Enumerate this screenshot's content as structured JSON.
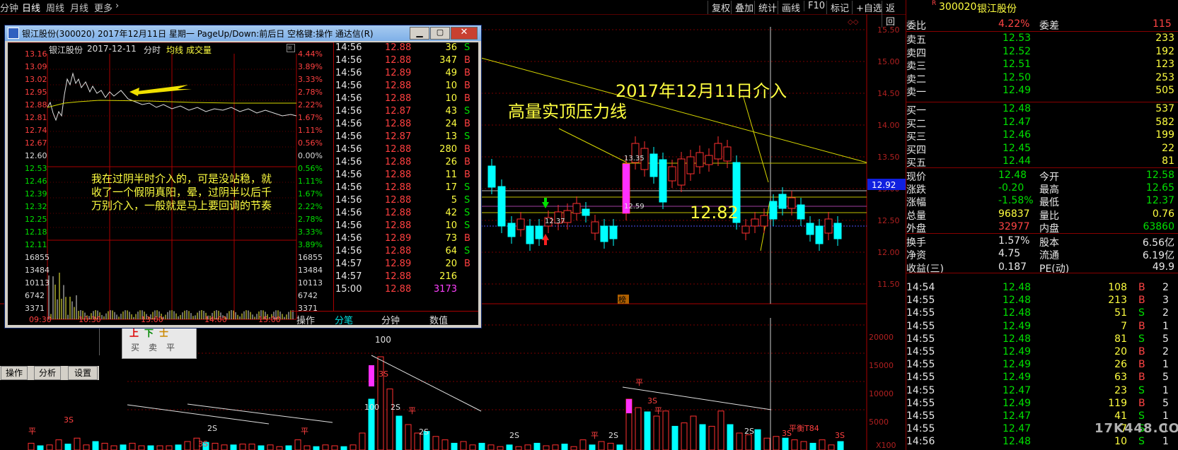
{
  "toolbar": {
    "left_items": [
      "分钟",
      "日线",
      "周线",
      "月线",
      "更多"
    ],
    "active": "日线",
    "right_items": [
      "复权",
      "叠加",
      "统计",
      "画线",
      "F10",
      "标记",
      "+自选",
      "返回"
    ]
  },
  "main_chart": {
    "price_ticks": [
      "15.50",
      "15.00",
      "14.50",
      "14.00",
      "13.50",
      "13.00",
      "12.50",
      "12.00",
      "11.50"
    ],
    "volume_ticks": [
      "20000",
      "15000",
      "10000",
      "5000",
      "X100"
    ],
    "current_price_label": "12.92",
    "annotation_date": "2017年12月11日介入",
    "annotation_line": "高量实顶压力线",
    "annotation_price": "12.82",
    "label_1335": "13.35",
    "label_1259": "12.59",
    "label_1237": "12.37",
    "label_100": "100",
    "small_mark": "榜",
    "vol_labels": [
      "3S",
      "100",
      "2S",
      "平",
      "2S",
      "3S",
      "平",
      "2S",
      "平",
      "3S",
      "平",
      "2S",
      "3S",
      "2S",
      "平",
      "3S",
      "平",
      "2S",
      "3S",
      "平衡T84"
    ]
  },
  "quote": {
    "code": "300020",
    "name": "银江股份",
    "r_mark": "R",
    "weibi_label": "委比",
    "weibi": "4.22%",
    "weicha_label": "委差",
    "weicha": "115",
    "sells": [
      {
        "label": "卖五",
        "price": "12.53",
        "vol": "233"
      },
      {
        "label": "卖四",
        "price": "12.52",
        "vol": "192"
      },
      {
        "label": "卖三",
        "price": "12.51",
        "vol": "123"
      },
      {
        "label": "卖二",
        "price": "12.50",
        "vol": "253"
      },
      {
        "label": "卖一",
        "price": "12.49",
        "vol": "505"
      }
    ],
    "buys": [
      {
        "label": "买一",
        "price": "12.48",
        "vol": "537"
      },
      {
        "label": "买二",
        "price": "12.47",
        "vol": "582"
      },
      {
        "label": "买三",
        "price": "12.46",
        "vol": "199"
      },
      {
        "label": "买四",
        "price": "12.45",
        "vol": "22"
      },
      {
        "label": "买五",
        "price": "12.44",
        "vol": "81"
      }
    ],
    "stats": [
      {
        "l1": "现价",
        "v1": "12.48",
        "c1": "green",
        "l2": "今开",
        "v2": "12.58",
        "c2": "green"
      },
      {
        "l1": "涨跌",
        "v1": "-0.20",
        "c1": "green",
        "l2": "最高",
        "v2": "12.65",
        "c2": "green"
      },
      {
        "l1": "涨幅",
        "v1": "-1.58%",
        "c1": "green",
        "l2": "最低",
        "v2": "12.37",
        "c2": "green"
      },
      {
        "l1": "总量",
        "v1": "96837",
        "c1": "yellow",
        "l2": "量比",
        "v2": "0.76",
        "c2": "yellow"
      },
      {
        "l1": "外盘",
        "v1": "32977",
        "c1": "red",
        "l2": "内盘",
        "v2": "63860",
        "c2": "green"
      }
    ],
    "stats2": [
      {
        "l1": "换手",
        "v1": "1.57%",
        "l2": "股本",
        "v2": "6.56亿"
      },
      {
        "l1": "净资",
        "v1": "4.75",
        "l2": "流通",
        "v2": "6.19亿"
      },
      {
        "l1": "收益(三)",
        "v1": "0.187",
        "l2": "PE(动)",
        "v2": "49.9"
      }
    ],
    "ticks": [
      {
        "t": "14:54",
        "p": "12.48",
        "pc": "green",
        "v": "108",
        "s": "B"
      },
      {
        "t": "14:55",
        "p": "12.48",
        "pc": "green",
        "v": "213",
        "s": "B"
      },
      {
        "t": "14:55",
        "p": "12.48",
        "pc": "green",
        "v": "51",
        "s": "S"
      },
      {
        "t": "14:55",
        "p": "12.49",
        "pc": "green",
        "v": "7",
        "s": "B"
      },
      {
        "t": "14:55",
        "p": "12.48",
        "pc": "green",
        "v": "81",
        "s": "S"
      },
      {
        "t": "14:55",
        "p": "12.49",
        "pc": "green",
        "v": "20",
        "s": "B"
      },
      {
        "t": "14:55",
        "p": "12.49",
        "pc": "green",
        "v": "26",
        "s": "B"
      },
      {
        "t": "14:55",
        "p": "12.49",
        "pc": "green",
        "v": "63",
        "s": "B"
      },
      {
        "t": "14:55",
        "p": "12.47",
        "pc": "green",
        "v": "23",
        "s": "S"
      },
      {
        "t": "14:55",
        "p": "12.49",
        "pc": "green",
        "v": "119",
        "s": "B"
      },
      {
        "t": "14:55",
        "p": "12.47",
        "pc": "green",
        "v": "41",
        "s": "S"
      },
      {
        "t": "14:55",
        "p": "12.47",
        "pc": "green",
        "v": "7",
        "s": "S"
      },
      {
        "t": "14:56",
        "p": "12.48",
        "pc": "green",
        "v": "10",
        "s": "S"
      }
    ],
    "edge_digits": [
      "2",
      "3",
      "2",
      "1",
      "5",
      "2",
      "1",
      "5",
      "1",
      "5",
      "1",
      "1",
      "1"
    ],
    "watermark": "17K448.COM"
  },
  "popup": {
    "title": "银江股份(300020) 2017年12月11日 星期一 PageUp/Down:前后日 空格键:操作 通达信(R)",
    "header_name": "银江股份",
    "header_date": "2017-12-11",
    "header_type": "分时",
    "header_avg": "均线",
    "header_vol": "成交量",
    "left_ticks": [
      "13.16",
      "13.09",
      "13.02",
      "12.95",
      "12.88",
      "12.81",
      "12.74",
      "12.67",
      "12.60",
      "12.53",
      "12.46",
      "12.39",
      "12.32",
      "12.25",
      "12.18",
      "12.11",
      "16855",
      "13484",
      "10113",
      "6742",
      "3371"
    ],
    "right_ticks": [
      "4.44%",
      "3.89%",
      "3.33%",
      "2.78%",
      "2.22%",
      "1.67%",
      "1.11%",
      "0.56%",
      "0.00%",
      "0.56%",
      "1.11%",
      "1.67%",
      "2.22%",
      "2.78%",
      "3.33%",
      "3.89%",
      "16855",
      "13484",
      "10113",
      "6742",
      "3371"
    ],
    "time_ticks": [
      "09:30",
      "10:30",
      "13:00",
      "14:00",
      "15:00"
    ],
    "note": "我在过阴半时介入的，可是没站稳，就收了一个假阴真阳，晕，过阴半以后千万别介入，一般就是马上要回调的节奏",
    "trades": [
      {
        "t": "14:56",
        "p": "12.88",
        "v": "36",
        "s": "S"
      },
      {
        "t": "14:56",
        "p": "12.88",
        "v": "347",
        "s": "B"
      },
      {
        "t": "14:56",
        "p": "12.89",
        "v": "49",
        "s": "B"
      },
      {
        "t": "14:56",
        "p": "12.88",
        "v": "10",
        "s": "B"
      },
      {
        "t": "14:56",
        "p": "12.88",
        "v": "10",
        "s": "B"
      },
      {
        "t": "14:56",
        "p": "12.87",
        "v": "43",
        "s": "S"
      },
      {
        "t": "14:56",
        "p": "12.88",
        "v": "24",
        "s": "B"
      },
      {
        "t": "14:56",
        "p": "12.87",
        "v": "13",
        "s": "S"
      },
      {
        "t": "14:56",
        "p": "12.88",
        "v": "280",
        "s": "B"
      },
      {
        "t": "14:56",
        "p": "12.88",
        "v": "26",
        "s": "B"
      },
      {
        "t": "14:56",
        "p": "12.88",
        "v": "11",
        "s": "B"
      },
      {
        "t": "14:56",
        "p": "12.88",
        "v": "17",
        "s": "S"
      },
      {
        "t": "14:56",
        "p": "12.88",
        "v": "5",
        "s": "S"
      },
      {
        "t": "14:56",
        "p": "12.88",
        "v": "42",
        "s": "S"
      },
      {
        "t": "14:56",
        "p": "12.88",
        "v": "10",
        "s": "S"
      },
      {
        "t": "14:56",
        "p": "12.89",
        "v": "73",
        "s": "B"
      },
      {
        "t": "14:56",
        "p": "12.88",
        "v": "64",
        "s": "S"
      },
      {
        "t": "14:57",
        "p": "12.89",
        "v": "20",
        "s": "B"
      },
      {
        "t": "14:57",
        "p": "12.88",
        "v": "216",
        "s": ""
      },
      {
        "t": "15:00",
        "p": "12.88",
        "v": "3173",
        "s": ""
      }
    ],
    "tabs": [
      "操作",
      "分笔",
      "分钟",
      "数值"
    ],
    "active_tab": "分笔"
  },
  "side_buttons": [
    "操作",
    "分析",
    "设置"
  ],
  "mini_panel": {
    "row1": "上下士",
    "row2": [
      "买",
      "卖",
      "平"
    ]
  }
}
